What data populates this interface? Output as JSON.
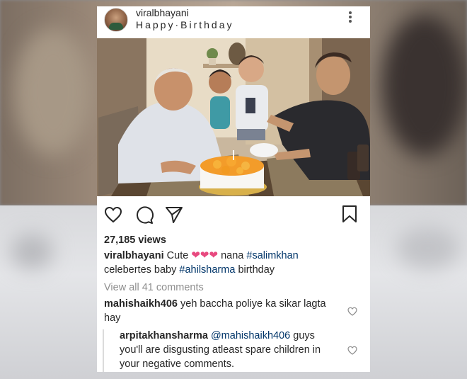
{
  "post": {
    "username": "viralbhayani",
    "location": "Happy·Birthday"
  },
  "stats": {
    "views": "27,185 views"
  },
  "caption": {
    "username": "viralbhayani",
    "text1": "Cute",
    "hearts": "❤❤❤",
    "text2": "nana",
    "tag1": "#salimkhan",
    "text3": "celebertes baby",
    "tag2": "#ahilsharma",
    "text4": "birthday"
  },
  "comments_link": "View all 41 comments",
  "comments": [
    {
      "username": "mahishaikh406",
      "text": "yeh baccha poliye ka sikar lagta hay"
    },
    {
      "username": "arpitakhansharma",
      "mention": "@mahishaikh406",
      "text": "guys you'll are disgusting atleast spare children in your negative comments."
    }
  ],
  "icons": {
    "like": "heart-outline-icon",
    "comment": "comment-bubble-icon",
    "share": "paper-plane-icon",
    "save": "bookmark-icon",
    "more": "more-vertical-icon"
  },
  "colors": {
    "text": "#262626",
    "hashtag": "#003569",
    "muted": "#8e8e8e",
    "heart_emoji": "#e8497f"
  }
}
